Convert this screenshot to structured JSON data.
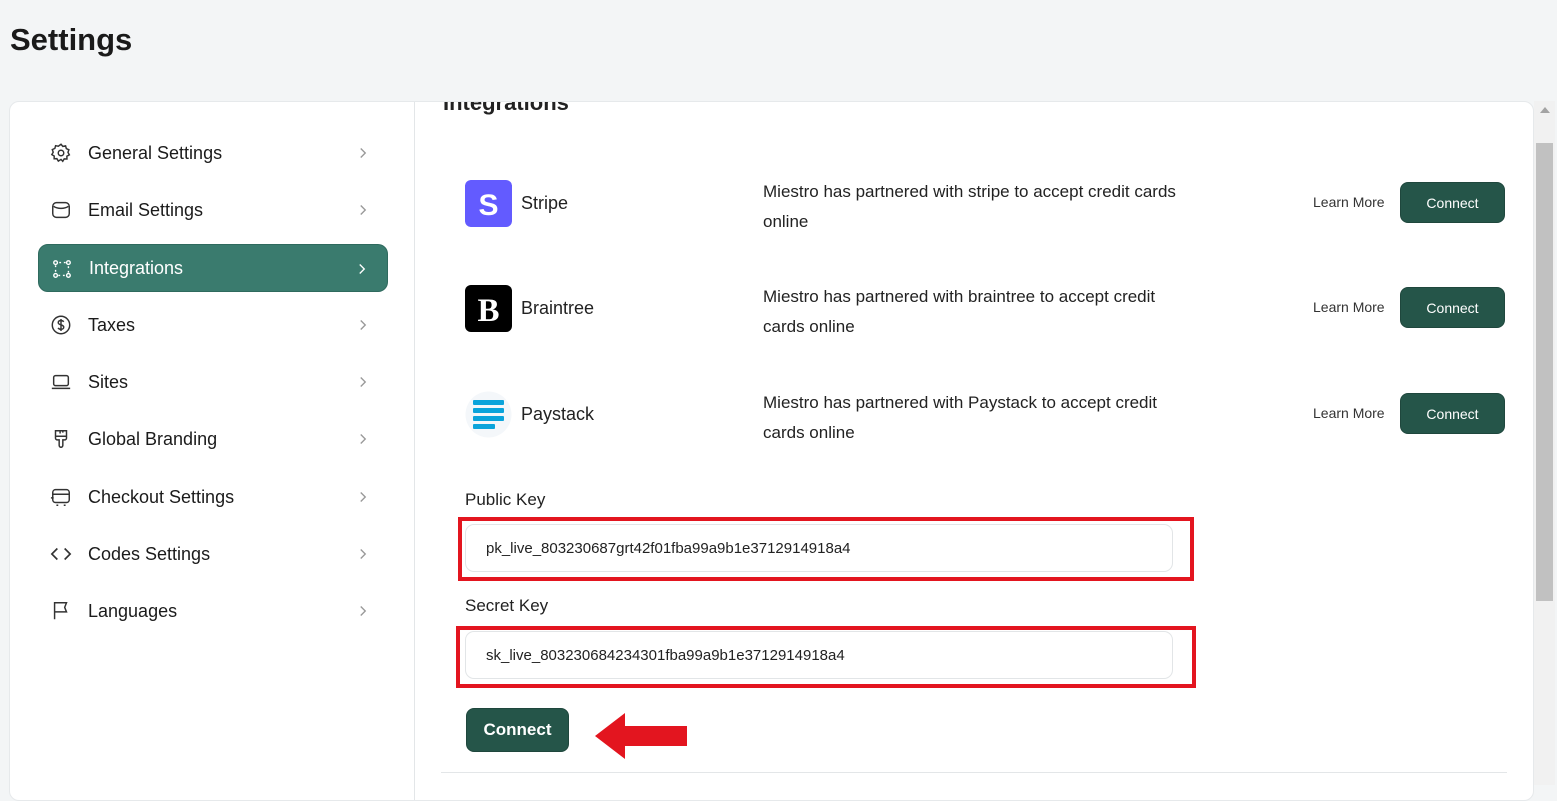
{
  "page": {
    "title": "Settings"
  },
  "sidebar": {
    "items": [
      {
        "label": "General Settings",
        "icon": "gear-icon",
        "active": false
      },
      {
        "label": "Email Settings",
        "icon": "envelope-icon",
        "active": false
      },
      {
        "label": "Integrations",
        "icon": "integrations-icon",
        "active": true
      },
      {
        "label": "Taxes",
        "icon": "dollar-circle-icon",
        "active": false
      },
      {
        "label": "Sites",
        "icon": "laptop-icon",
        "active": false
      },
      {
        "label": "Global Branding",
        "icon": "brush-icon",
        "active": false
      },
      {
        "label": "Checkout Settings",
        "icon": "cart-icon",
        "active": false
      },
      {
        "label": "Codes Settings",
        "icon": "code-icon",
        "active": false
      },
      {
        "label": "Languages",
        "icon": "flag-icon",
        "active": false
      }
    ]
  },
  "main": {
    "section_title": "Integrations",
    "integrations": [
      {
        "name": "Stripe",
        "logo": "stripe-logo",
        "description": "Miestro has partnered with stripe to accept credit cards online",
        "learn_more": "Learn More",
        "connect": "Connect"
      },
      {
        "name": "Braintree",
        "logo": "braintree-logo",
        "description": "Miestro has partnered with braintree to accept credit cards online",
        "learn_more": "Learn More",
        "connect": "Connect"
      },
      {
        "name": "Paystack",
        "logo": "paystack-logo",
        "description": "Miestro has partnered with Paystack to accept credit cards online",
        "learn_more": "Learn More",
        "connect": "Connect"
      }
    ],
    "public_key": {
      "label": "Public Key",
      "value": "pk_live_803230687grt42f01fba99a9b1e3712914918a4"
    },
    "secret_key": {
      "label": "Secret Key",
      "value": "sk_live_803230684234301fba99a9b1e3712914918a4"
    },
    "connect_button": "Connect"
  },
  "colors": {
    "accent": "#3a7b6e",
    "button": "#255549",
    "highlight": "#e3151f",
    "stripe": "#635bff"
  }
}
